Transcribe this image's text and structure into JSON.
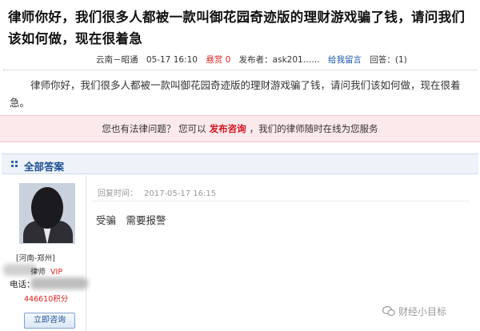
{
  "question": {
    "title": "律师你好，我们很多人都被一款叫御花园奇迹版的理财游戏骗了钱，请问我们该如何做，现在很着急",
    "meta": {
      "location": "云南－昭通",
      "date": "05-17 16:10",
      "reward": "悬赏 0",
      "author": "发布者：ask201……",
      "message_link": "给我留言",
      "answers": "回答：(1)"
    },
    "body": "律师你好，我们很多人都被一款叫御花园奇迹版的理财游戏骗了钱，请问我们该如何做，现在很着急。"
  },
  "banner": {
    "prefix": "您也有法律问题？ 您可以",
    "link": "发布咨询",
    "suffix": "，我们的律师随时在线为您服务"
  },
  "answers_section": {
    "header": "全部答案"
  },
  "answer": {
    "lawyer": {
      "location": "[河南-郑州]",
      "role": "律师",
      "vip": "VIP",
      "phone_label": "电话：",
      "points": "446610积分",
      "consult_button": "立即咨询"
    },
    "reply_time_label": "回复时间：",
    "reply_time": "2017-05-17 16:15",
    "text": "受骗　需要报警"
  },
  "watermark": "财经小目标",
  "colors": {
    "accent_red": "#d4141e",
    "link_blue": "#1a55b0",
    "header_blue": "#1f4f93",
    "banner_bg": "#fce9ec"
  }
}
